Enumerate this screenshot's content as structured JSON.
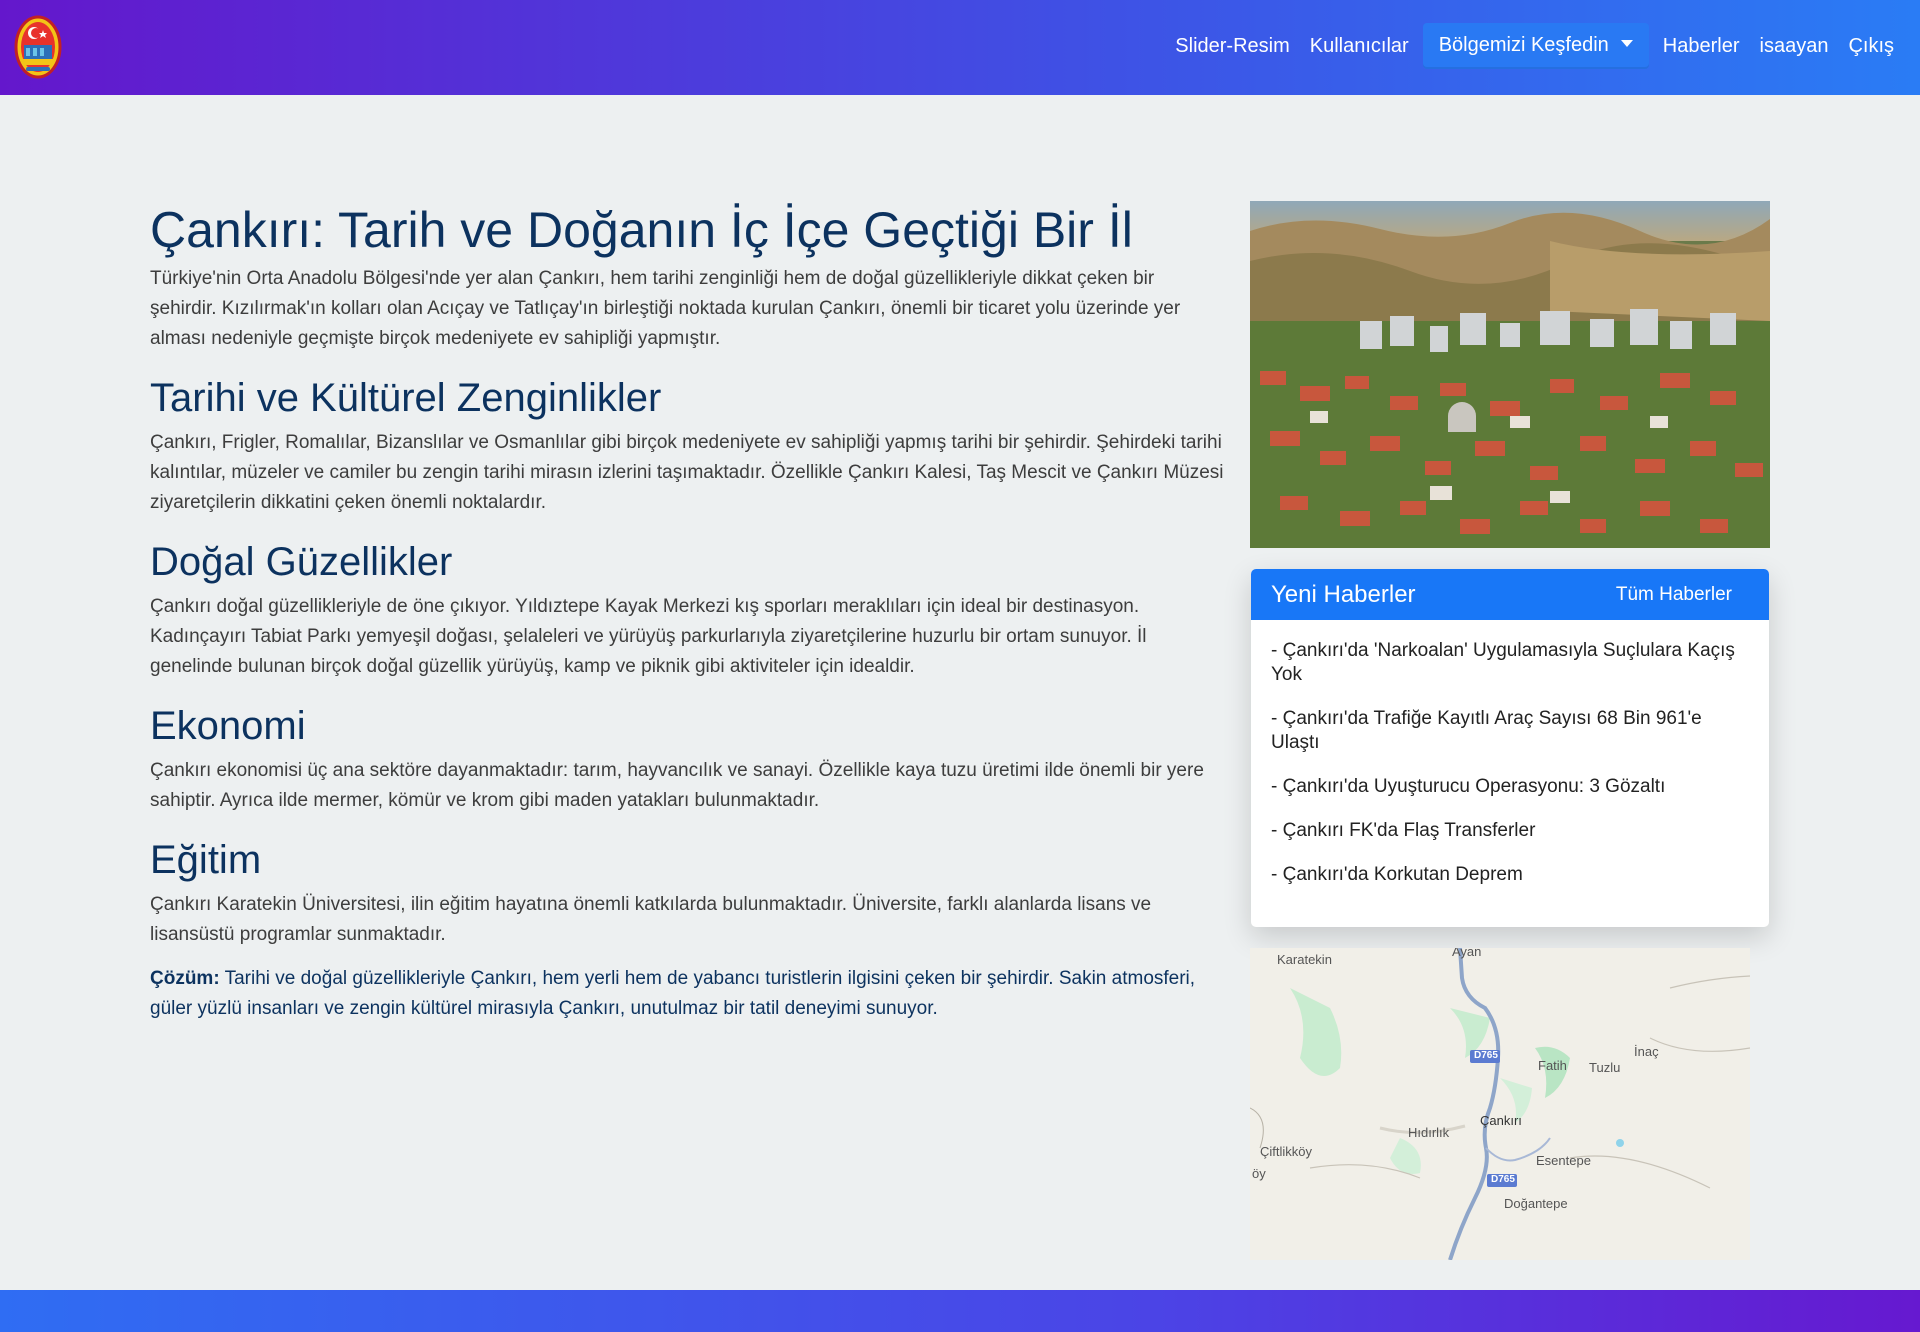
{
  "nav": {
    "links": [
      "Slider-Resim",
      "Kullanıcılar",
      "Haberler",
      "isaayan",
      "Çıkış"
    ],
    "dropdown_label": "Bölgemizi Keşfedin"
  },
  "article": {
    "title": "Çankırı: Tarih ve Doğanın İç İçe Geçtiği Bir İl",
    "intro": "Türkiye'nin Orta Anadolu Bölgesi'nde yer alan Çankırı, hem tarihi zenginliği hem de doğal güzellikleriyle dikkat çeken bir şehirdir. Kızılırmak'ın kolları olan Acıçay ve Tatlıçay'ın birleştiği noktada kurulan Çankırı, önemli bir ticaret yolu üzerinde yer alması nedeniyle geçmişte birçok medeniyete ev sahipliği yapmıştır.",
    "sections": [
      {
        "heading": "Tarihi ve Kültürel Zenginlikler",
        "text": "Çankırı, Frigler, Romalılar, Bizanslılar ve Osmanlılar gibi birçok medeniyete ev sahipliği yapmış tarihi bir şehirdir. Şehirdeki tarihi kalıntılar, müzeler ve camiler bu zengin tarihi mirasın izlerini taşımaktadır. Özellikle Çankırı Kalesi, Taş Mescit ve Çankırı Müzesi ziyaretçilerin dikkatini çeken önemli noktalardır."
      },
      {
        "heading": "Doğal Güzellikler",
        "text": "Çankırı doğal güzellikleriyle de öne çıkıyor. Yıldıztepe Kayak Merkezi kış sporları meraklıları için ideal bir destinasyon. Kadınçayırı Tabiat Parkı yemyeşil doğası, şelaleleri ve yürüyüş parkurlarıyla ziyaretçilerine huzurlu bir ortam sunuyor. İl genelinde bulunan birçok doğal güzellik yürüyüş, kamp ve piknik gibi aktiviteler için idealdir."
      },
      {
        "heading": "Ekonomi",
        "text": "Çankırı ekonomisi üç ana sektöre dayanmaktadır: tarım, hayvancılık ve sanayi. Özellikle kaya tuzu üretimi ilde önemli bir yere sahiptir. Ayrıca ilde mermer, kömür ve krom gibi maden yatakları bulunmaktadır."
      },
      {
        "heading": "Eğitim",
        "text": "Çankırı Karatekin Üniversitesi, ilin eğitim hayatına önemli katkılarda bulunmaktadır. Üniversite, farklı alanlarda lisans ve lisansüstü programlar sunmaktadır."
      }
    ],
    "solution_label": "Çözüm:",
    "solution_text": " Tarihi ve doğal güzellikleriyle Çankırı, hem yerli hem de yabancı turistlerin ilgisini çeken bir şehirdir. Sakin atmosferi, güler yüzlü insanları ve zengin kültürel mirasıyla Çankırı, unutulmaz bir tatil deneyimi sunuyor."
  },
  "news": {
    "title": "Yeni Haberler",
    "all_link": "Tüm Haberler",
    "items": [
      "- Çankırı'da 'Narkoalan' Uygulamasıyla Suçlulara Kaçış Yok",
      "- Çankırı'da Trafiğe Kayıtlı Araç Sayısı 68 Bin 961'e Ulaştı",
      "- Çankırı'da Uyuşturucu Operasyonu: 3 Gözaltı",
      "- Çankırı FK'da Flaş Transferler",
      "- Çankırı'da Korkutan Deprem"
    ]
  },
  "map": {
    "labels": [
      "Karatekin",
      "Ayan",
      "D765",
      "Fatih",
      "Tuzlu",
      "İnaç",
      "Hıdırlık",
      "Çankırı",
      "Çiftlikköy",
      "öy",
      "Esentepe",
      "D765",
      "Doğantepe"
    ]
  },
  "colors": {
    "nav_gradient_start": "#6417cc",
    "nav_gradient_end": "#2a7cf5",
    "heading": "#0c325f",
    "news_header": "#1877f7"
  }
}
